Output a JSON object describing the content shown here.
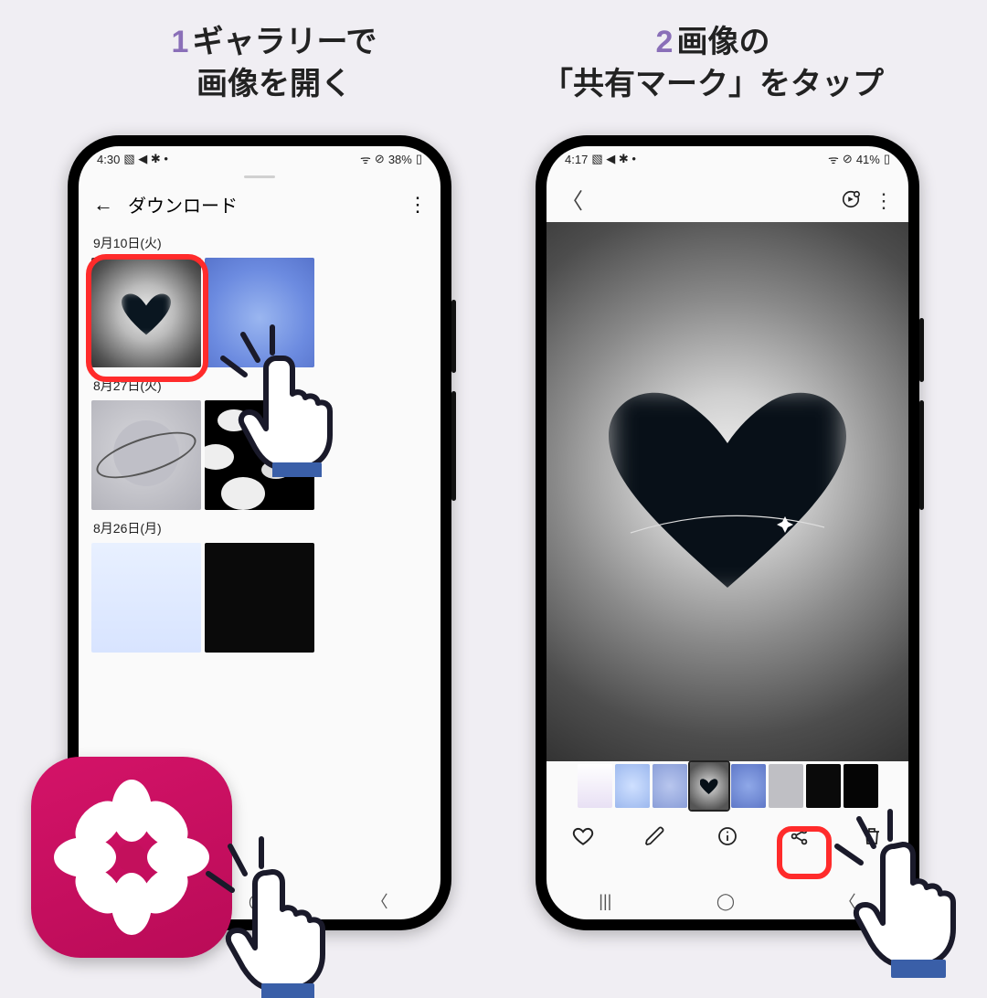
{
  "captions": {
    "step1": {
      "num": "1",
      "line1": "ギャラリーで",
      "line2": "画像を開く"
    },
    "step2": {
      "num": "2",
      "line1": "画像の",
      "line2": "「共有マーク」をタップ"
    }
  },
  "phone1": {
    "status": {
      "time": "4:30",
      "battery": "38%"
    },
    "header": {
      "title": "ダウンロード"
    },
    "dates": {
      "d1": "9月10日(火)",
      "d2": "8月27日(火)",
      "d3": "8月26日(月)"
    }
  },
  "phone2": {
    "status": {
      "time": "4:17",
      "battery": "41%"
    }
  }
}
